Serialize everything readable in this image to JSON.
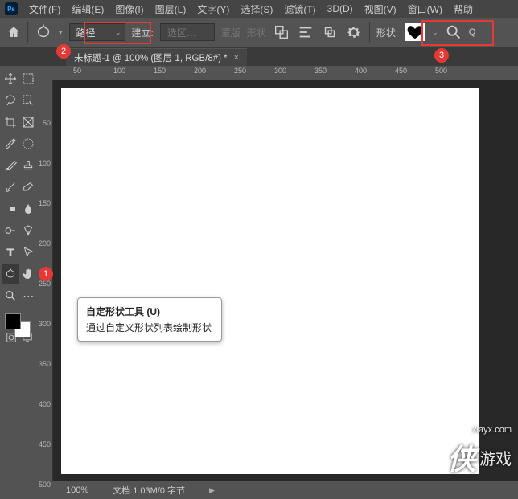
{
  "menu": {
    "items": [
      "文件(F)",
      "编辑(E)",
      "图像(I)",
      "图层(L)",
      "文字(Y)",
      "选择(S)",
      "滤镜(T)",
      "3D(D)",
      "视图(V)",
      "窗口(W)",
      "帮助"
    ]
  },
  "optbar": {
    "mode_label": "路径",
    "build_label": "建立:",
    "selection": "选区…",
    "mask": "蒙版",
    "shape": "形状",
    "shape_label": "形状:",
    "q": "Q"
  },
  "doc": {
    "title": "未标题-1 @ 100% (图层 1, RGB/8#) *"
  },
  "rulers": {
    "h": [
      "50",
      "100",
      "150",
      "200",
      "250",
      "300",
      "350",
      "400",
      "450",
      "500"
    ],
    "v": [
      "50",
      "100",
      "150",
      "200",
      "250",
      "300",
      "350",
      "400",
      "450",
      "500"
    ]
  },
  "tooltip": {
    "title": "自定形状工具 (U)",
    "desc": "通过自定义形状列表绘制形状"
  },
  "status": {
    "zoom": "100%",
    "docinfo": "文档:1.03M/0 字节"
  },
  "badges": {
    "b1": "1",
    "b2": "2",
    "b3": "3"
  },
  "watermark": {
    "url": "xiayx.com",
    "text": "游戏"
  }
}
